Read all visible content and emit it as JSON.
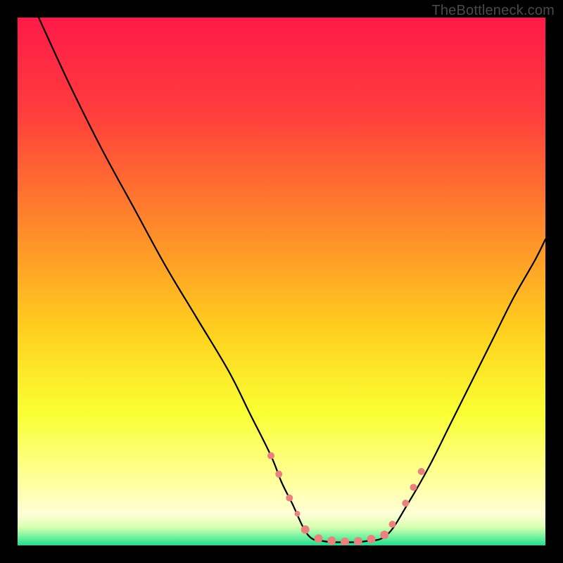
{
  "watermark": "TheBottleneck.com",
  "chart_data": {
    "type": "line",
    "title": "",
    "xlabel": "",
    "ylabel": "",
    "xlim": [
      0,
      100
    ],
    "ylim": [
      0,
      100
    ],
    "gradient_stops": [
      {
        "offset": 0,
        "color": "#ff1a48"
      },
      {
        "offset": 0.18,
        "color": "#ff3d3d"
      },
      {
        "offset": 0.4,
        "color": "#ff8a2a"
      },
      {
        "offset": 0.6,
        "color": "#ffd21f"
      },
      {
        "offset": 0.75,
        "color": "#f9ff33"
      },
      {
        "offset": 0.88,
        "color": "#ffff9e"
      },
      {
        "offset": 0.94,
        "color": "#ffffd8"
      },
      {
        "offset": 0.965,
        "color": "#d9ffb0"
      },
      {
        "offset": 0.985,
        "color": "#6cf2a0"
      },
      {
        "offset": 1.0,
        "color": "#1fdc8c"
      }
    ],
    "series": [
      {
        "name": "left-curve",
        "x": [
          4,
          10,
          16,
          22,
          28,
          34,
          40,
          44,
          48,
          50,
          52,
          55
        ],
        "y": [
          100,
          87,
          75,
          64,
          53,
          43,
          33,
          25,
          17,
          12,
          8,
          2
        ]
      },
      {
        "name": "trough",
        "x": [
          55,
          58,
          62,
          66,
          70
        ],
        "y": [
          2,
          0.8,
          0.6,
          0.8,
          2
        ]
      },
      {
        "name": "right-curve",
        "x": [
          70,
          74,
          78,
          82,
          86,
          90,
          94,
          98,
          100
        ],
        "y": [
          2,
          8,
          15,
          23,
          31,
          39,
          47,
          54,
          58
        ]
      }
    ],
    "markers": {
      "name": "highlight-dots",
      "color": "#e9827f",
      "points": [
        {
          "x": 48.0,
          "y": 17.0,
          "r": 5
        },
        {
          "x": 49.5,
          "y": 13.5,
          "r": 5
        },
        {
          "x": 51.5,
          "y": 9.0,
          "r": 5
        },
        {
          "x": 53.0,
          "y": 6.0,
          "r": 4
        },
        {
          "x": 54.5,
          "y": 3.0,
          "r": 6
        },
        {
          "x": 57.0,
          "y": 1.3,
          "r": 6
        },
        {
          "x": 59.5,
          "y": 0.9,
          "r": 6
        },
        {
          "x": 62.0,
          "y": 0.7,
          "r": 6
        },
        {
          "x": 64.5,
          "y": 0.8,
          "r": 6
        },
        {
          "x": 67.0,
          "y": 1.2,
          "r": 6
        },
        {
          "x": 69.5,
          "y": 2.0,
          "r": 6
        },
        {
          "x": 71.0,
          "y": 4.0,
          "r": 5
        },
        {
          "x": 73.5,
          "y": 8.0,
          "r": 5
        },
        {
          "x": 75.0,
          "y": 11.0,
          "r": 5
        },
        {
          "x": 76.5,
          "y": 14.0,
          "r": 5
        }
      ]
    }
  }
}
